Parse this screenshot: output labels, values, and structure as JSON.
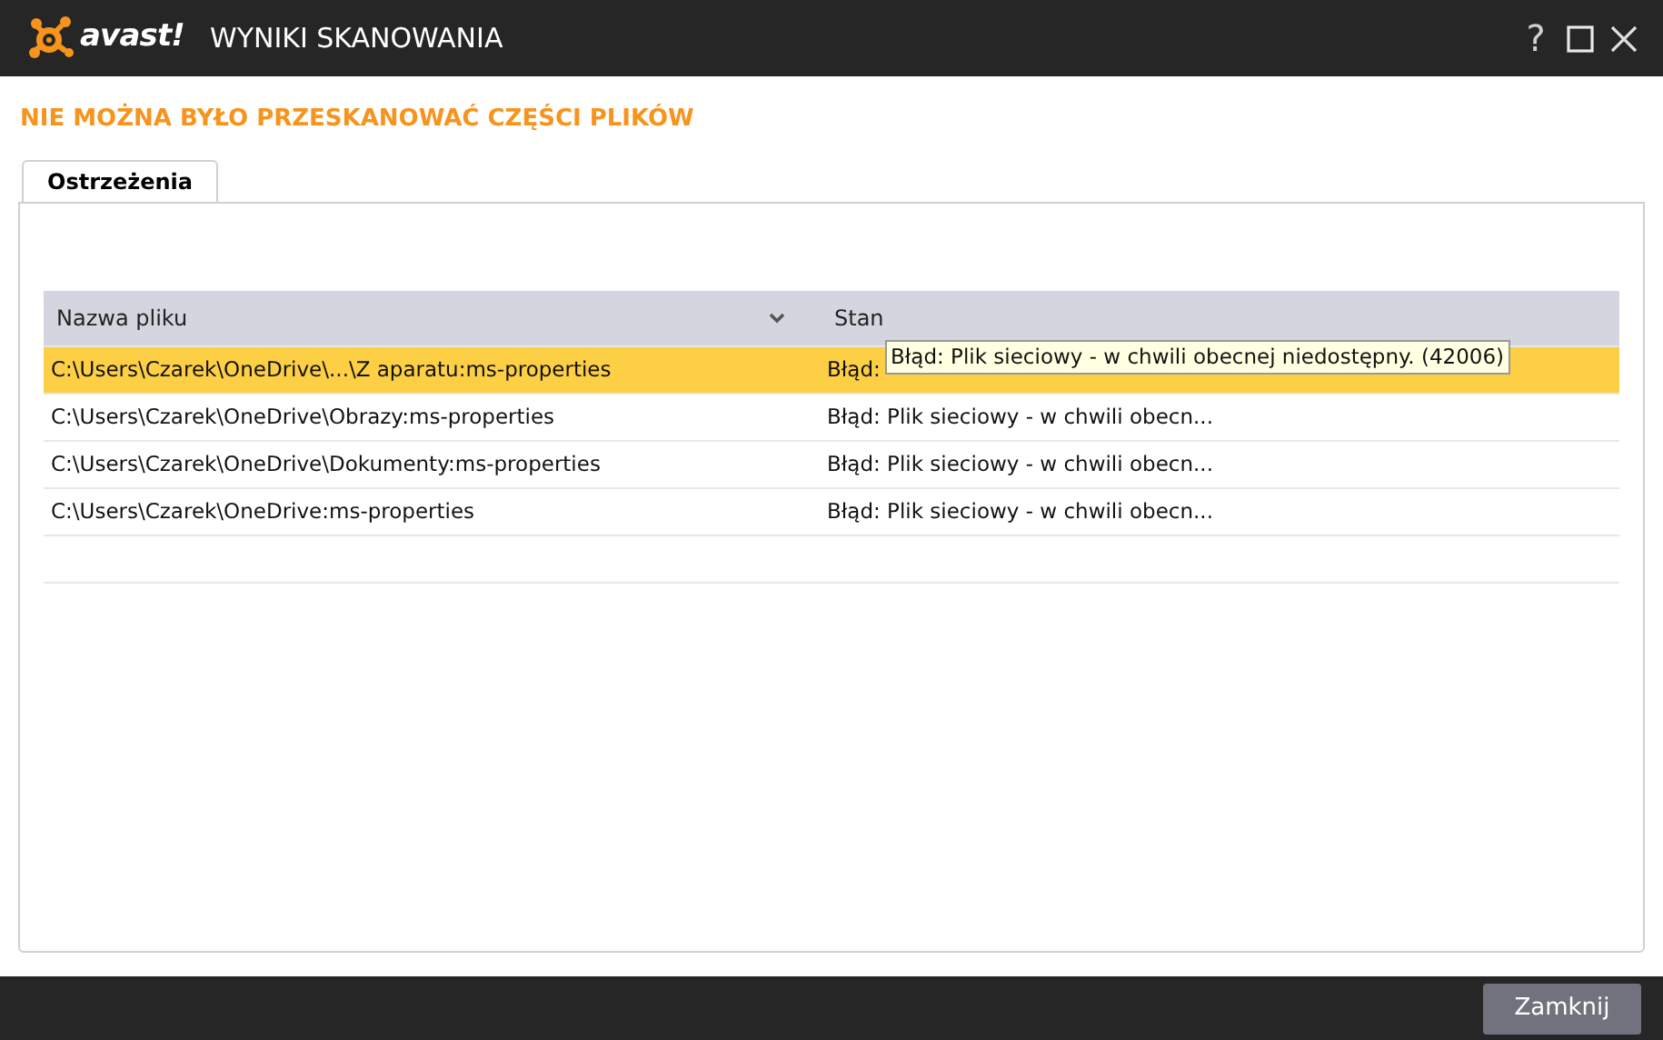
{
  "window": {
    "logo_text": "avast!",
    "title": "WYNIKI SKANOWANIA",
    "controls": [
      {
        "kind": "help",
        "label": "?"
      },
      {
        "kind": "maximize"
      },
      {
        "kind": "close"
      }
    ]
  },
  "heading": "NIE MOŻNA BYŁO PRZESKANOWAĆ CZĘŚCI PLIKÓW",
  "tabs": [
    {
      "label": "Ostrzeżenia",
      "selected": true
    }
  ],
  "table": {
    "columns": [
      {
        "label": "Nazwa pliku",
        "sorted": true
      },
      {
        "label": "Stan",
        "sorted": false
      }
    ],
    "rows": [
      {
        "file": "C:\\Users\\Czarek\\OneDrive\\...\\Z aparatu:ms-properties",
        "status": "Błąd:",
        "selected": true
      },
      {
        "file": "C:\\Users\\Czarek\\OneDrive\\Obrazy:ms-properties",
        "status": "Błąd: Plik sieciowy - w chwili obecn...",
        "selected": false
      },
      {
        "file": "C:\\Users\\Czarek\\OneDrive\\Dokumenty:ms-properties",
        "status": "Błąd: Plik sieciowy - w chwili obecn...",
        "selected": false
      },
      {
        "file": "C:\\Users\\Czarek\\OneDrive:ms-properties",
        "status": "Błąd: Plik sieciowy - w chwili obecn...",
        "selected": false
      }
    ]
  },
  "tooltip": "Błąd: Plik sieciowy - w chwili obecnej niedostępny. (42006)",
  "buttons": [
    {
      "label": "Zamknij"
    }
  ]
}
